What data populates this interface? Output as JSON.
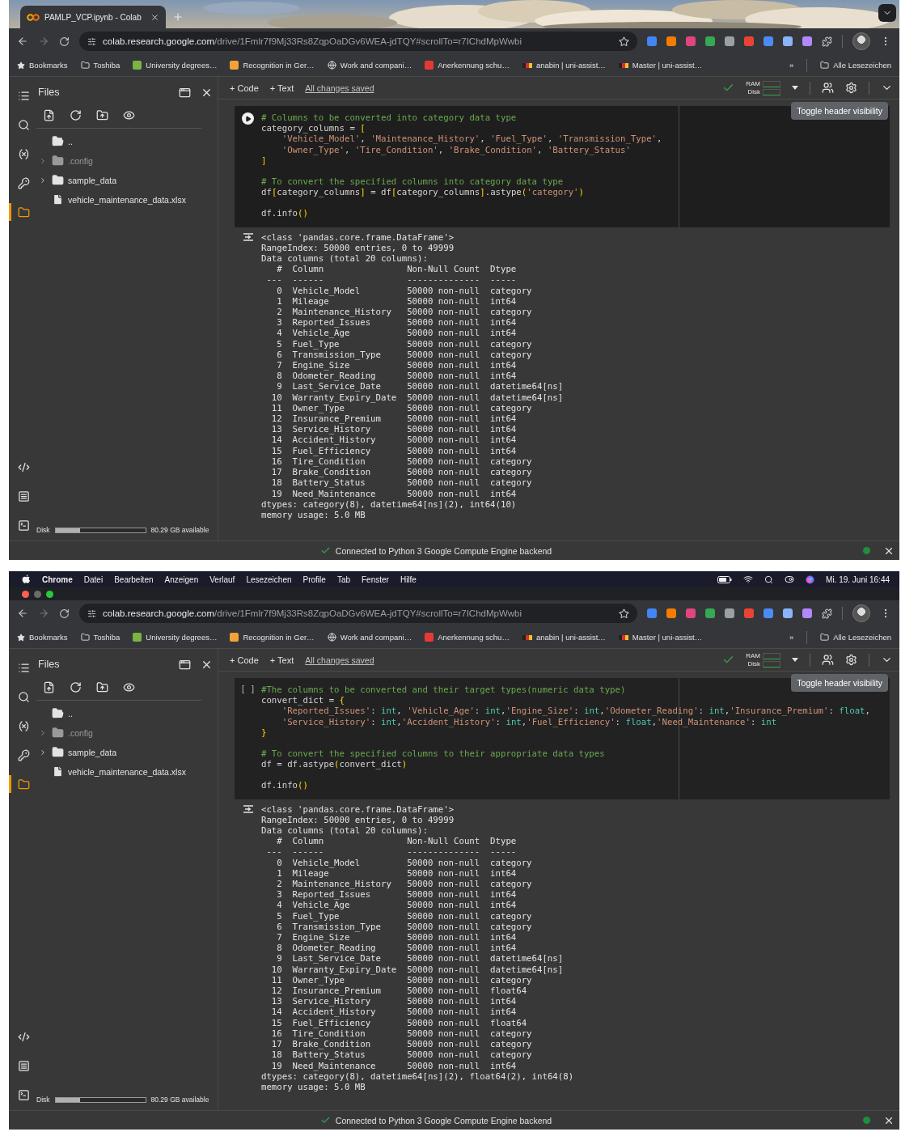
{
  "windows": [
    {
      "tabs": [
        {
          "title": "PAMLP_VCP.ipynb - Colab",
          "selected": true
        }
      ],
      "address": {
        "host": "colab.research.google.com",
        "path": "/drive/1Fmlr7f9Mj33Rs8ZqpOaDGv6WEA-jdTQY#scrollTo=r7IChdMpWwbi"
      },
      "bookmarks": [
        {
          "label": "Bookmarks",
          "kind": "star"
        },
        {
          "label": "Toshiba",
          "kind": "folder"
        },
        {
          "label": "University degrees…",
          "kind": "site",
          "color": "#7cb342"
        },
        {
          "label": "Recognition in Ger…",
          "kind": "site",
          "color": "#f4a13a"
        },
        {
          "label": "Work and compani…",
          "kind": "globe"
        },
        {
          "label": "Anerkennung schu…",
          "kind": "site",
          "color": "#e53935"
        },
        {
          "label": "anabin | uni-assist…",
          "kind": "flag",
          "color": "#d32f2f"
        },
        {
          "label": "Master | uni-assist…",
          "kind": "flag",
          "color": "#d32f2f"
        }
      ],
      "more_bookmarks": "»",
      "all_bookmarks": "Alle Lesezeichen",
      "rail": [
        {
          "kind": "toc",
          "selected": false
        },
        {
          "kind": "search",
          "selected": false
        },
        {
          "kind": "variables",
          "selected": false
        },
        {
          "kind": "secrets",
          "selected": false
        },
        {
          "kind": "files",
          "selected": true
        }
      ],
      "rail_bottom": [
        {
          "kind": "code",
          "selected": false
        },
        {
          "kind": "snippets",
          "selected": false
        },
        {
          "kind": "terminal",
          "selected": false
        }
      ],
      "files": {
        "title": "Files",
        "tree": [
          {
            "name": "..",
            "kind": "parent"
          },
          {
            "name": ".config",
            "kind": "folder",
            "expanded": false,
            "dimmed": true
          },
          {
            "name": "sample_data",
            "kind": "folder",
            "expanded": false,
            "dimmed": false
          },
          {
            "name": "vehicle_maintenance_data.xlsx",
            "kind": "file"
          }
        ],
        "disk": {
          "label": "Disk",
          "level": 0.27,
          "reading": "80.29 GB available"
        }
      },
      "toolbar": {
        "add_code": "+ Code",
        "add_text": "+ Text",
        "save_status": "All changes saved",
        "ram": "RAM",
        "disk": "Disk",
        "tooltip": "Toggle header visibility"
      },
      "cell": {
        "focused": true,
        "code": [
          [
            {
              "tokens": [
                {
                  "kind": "comment",
                  "text": "# Columns to be converted into category data type"
                }
              ]
            },
            {
              "tokens": [
                {
                  "kind": "plain",
                  "text": "category_columns = "
                },
                {
                  "kind": "bracket",
                  "text": "["
                }
              ]
            },
            {
              "indented": true,
              "tokens": [
                {
                  "kind": "string",
                  "text": "'Vehicle_Model'"
                },
                {
                  "kind": "plain",
                  "text": ", "
                },
                {
                  "kind": "string",
                  "text": "'Maintenance_History'"
                },
                {
                  "kind": "plain",
                  "text": ", "
                },
                {
                  "kind": "string",
                  "text": "'Fuel_Type'"
                },
                {
                  "kind": "plain",
                  "text": ", "
                },
                {
                  "kind": "string",
                  "text": "'Transmission_Type'"
                },
                {
                  "kind": "plain",
                  "text": ","
                }
              ]
            },
            {
              "indented": true,
              "tokens": [
                {
                  "kind": "string",
                  "text": "'Owner_Type'"
                },
                {
                  "kind": "plain",
                  "text": ", "
                },
                {
                  "kind": "string",
                  "text": "'Tire_Condition'"
                },
                {
                  "kind": "plain",
                  "text": ", "
                },
                {
                  "kind": "string",
                  "text": "'Brake_Condition'"
                },
                {
                  "kind": "plain",
                  "text": ", "
                },
                {
                  "kind": "string",
                  "text": "'Battery_Status'"
                }
              ]
            },
            {
              "tokens": [
                {
                  "kind": "bracket",
                  "text": "]"
                }
              ]
            }
          ],
          [
            {
              "tokens": [
                {
                  "kind": "comment",
                  "text": "# To convert the specified columns into category data type"
                }
              ]
            },
            {
              "tokens": [
                {
                  "kind": "plain",
                  "text": "df"
                },
                {
                  "kind": "bracket",
                  "text": "["
                },
                {
                  "kind": "plain",
                  "text": "category_columns"
                },
                {
                  "kind": "bracket",
                  "text": "]"
                },
                {
                  "kind": "plain",
                  "text": " = df"
                },
                {
                  "kind": "bracket",
                  "text": "["
                },
                {
                  "kind": "plain",
                  "text": "category_columns"
                },
                {
                  "kind": "bracket",
                  "text": "]"
                },
                {
                  "kind": "plain",
                  "text": ".astype"
                },
                {
                  "kind": "bracket",
                  "text": "("
                },
                {
                  "kind": "string",
                  "text": "'category'"
                },
                {
                  "kind": "bracket",
                  "text": ")"
                }
              ]
            }
          ],
          [
            {
              "tokens": [
                {
                  "kind": "plain",
                  "text": "df.info"
                },
                {
                  "kind": "bracket",
                  "text": "()"
                }
              ]
            }
          ]
        ],
        "output": {
          "lines": [
            "<class 'pandas.core.frame.DataFrame'>",
            "RangeIndex: 50000 entries, 0 to 49999",
            "Data columns (total 20 columns):"
          ],
          "columns": [
            "#",
            "Column",
            "Non-Null Count",
            "Dtype"
          ],
          "rules": [
            "---",
            "------",
            "--------------",
            "-----"
          ],
          "rows": [
            [
              "0",
              "Vehicle_Model",
              "50000 non-null",
              "category"
            ],
            [
              "1",
              "Mileage",
              "50000 non-null",
              "int64"
            ],
            [
              "2",
              "Maintenance_History",
              "50000 non-null",
              "category"
            ],
            [
              "3",
              "Reported_Issues",
              "50000 non-null",
              "int64"
            ],
            [
              "4",
              "Vehicle_Age",
              "50000 non-null",
              "int64"
            ],
            [
              "5",
              "Fuel_Type",
              "50000 non-null",
              "category"
            ],
            [
              "6",
              "Transmission_Type",
              "50000 non-null",
              "category"
            ],
            [
              "7",
              "Engine_Size",
              "50000 non-null",
              "int64"
            ],
            [
              "8",
              "Odometer_Reading",
              "50000 non-null",
              "int64"
            ],
            [
              "9",
              "Last_Service_Date",
              "50000 non-null",
              "datetime64[ns]"
            ],
            [
              "10",
              "Warranty_Expiry_Date",
              "50000 non-null",
              "datetime64[ns]"
            ],
            [
              "11",
              "Owner_Type",
              "50000 non-null",
              "category"
            ],
            [
              "12",
              "Insurance_Premium",
              "50000 non-null",
              "int64"
            ],
            [
              "13",
              "Service_History",
              "50000 non-null",
              "int64"
            ],
            [
              "14",
              "Accident_History",
              "50000 non-null",
              "int64"
            ],
            [
              "15",
              "Fuel_Efficiency",
              "50000 non-null",
              "int64"
            ],
            [
              "16",
              "Tire_Condition",
              "50000 non-null",
              "category"
            ],
            [
              "17",
              "Brake_Condition",
              "50000 non-null",
              "category"
            ],
            [
              "18",
              "Battery_Status",
              "50000 non-null",
              "category"
            ],
            [
              "19",
              "Need_Maintenance",
              "50000 non-null",
              "int64"
            ]
          ],
          "footer": [
            "dtypes: category(8), datetime64[ns](2), int64(10)",
            "memory usage: 5.0 MB"
          ]
        }
      },
      "status": "Connected to Python 3 Google Compute Engine backend"
    },
    {
      "menu_bar": {
        "items": [
          {
            "label": "Chrome",
            "kind": "app"
          },
          {
            "label": "Datei",
            "kind": "menu"
          },
          {
            "label": "Bearbeiten",
            "kind": "menu"
          },
          {
            "label": "Anzeigen",
            "kind": "menu"
          },
          {
            "label": "Verlauf",
            "kind": "menu"
          },
          {
            "label": "Lesezeichen",
            "kind": "menu"
          },
          {
            "label": "Profile",
            "kind": "menu"
          },
          {
            "label": "Tab",
            "kind": "menu"
          },
          {
            "label": "Fenster",
            "kind": "menu"
          },
          {
            "label": "Hilfe",
            "kind": "menu"
          }
        ],
        "clock": "Mi. 19. Juni  16:44"
      },
      "address": {
        "host": "colab.research.google.com",
        "path": "/drive/1Fmlr7f9Mj33Rs8ZqpOaDGv6WEA-jdTQY#scrollTo=r7IChdMpWwbi"
      },
      "bookmarks": [
        {
          "label": "Bookmarks",
          "kind": "star"
        },
        {
          "label": "Toshiba",
          "kind": "folder"
        },
        {
          "label": "University degrees…",
          "kind": "site",
          "color": "#7cb342"
        },
        {
          "label": "Recognition in Ger…",
          "kind": "site",
          "color": "#f4a13a"
        },
        {
          "label": "Work and compani…",
          "kind": "globe"
        },
        {
          "label": "Anerkennung schu…",
          "kind": "site",
          "color": "#e53935"
        },
        {
          "label": "anabin | uni-assist…",
          "kind": "flag",
          "color": "#d32f2f"
        },
        {
          "label": "Master | uni-assist…",
          "kind": "flag",
          "color": "#d32f2f"
        }
      ],
      "more_bookmarks": "»",
      "all_bookmarks": "Alle Lesezeichen",
      "rail": [
        {
          "kind": "toc",
          "selected": false
        },
        {
          "kind": "search",
          "selected": false
        },
        {
          "kind": "variables",
          "selected": false
        },
        {
          "kind": "secrets",
          "selected": false
        },
        {
          "kind": "files",
          "selected": true
        }
      ],
      "rail_bottom": [
        {
          "kind": "code",
          "selected": false
        },
        {
          "kind": "snippets",
          "selected": false
        },
        {
          "kind": "terminal",
          "selected": false
        }
      ],
      "files": {
        "title": "Files",
        "tree": [
          {
            "name": "..",
            "kind": "parent"
          },
          {
            "name": ".config",
            "kind": "folder",
            "expanded": false,
            "dimmed": true
          },
          {
            "name": "sample_data",
            "kind": "folder",
            "expanded": false,
            "dimmed": false
          },
          {
            "name": "vehicle_maintenance_data.xlsx",
            "kind": "file"
          }
        ],
        "disk": {
          "label": "Disk",
          "level": 0.27,
          "reading": "80.29 GB available"
        }
      },
      "toolbar": {
        "add_code": "+ Code",
        "add_text": "+ Text",
        "save_status": "All changes saved",
        "ram": "RAM",
        "disk": "Disk",
        "tooltip": "Toggle header visibility"
      },
      "cell": {
        "focused": false,
        "prompt": "[ ]",
        "code": [
          [
            {
              "tokens": [
                {
                  "kind": "comment",
                  "text": "#The columns to be converted and their target types(numeric data type)"
                }
              ]
            },
            {
              "tokens": [
                {
                  "kind": "plain",
                  "text": "convert_dict = "
                },
                {
                  "kind": "bracket",
                  "text": "{"
                }
              ]
            },
            {
              "indented": true,
              "tokens": [
                {
                  "kind": "string",
                  "text": "'Reported_Issues'"
                },
                {
                  "kind": "plain",
                  "text": ": "
                },
                {
                  "kind": "type",
                  "text": "int"
                },
                {
                  "kind": "plain",
                  "text": ", "
                },
                {
                  "kind": "string",
                  "text": "'Vehicle_Age'"
                },
                {
                  "kind": "plain",
                  "text": ": "
                },
                {
                  "kind": "type",
                  "text": "int"
                },
                {
                  "kind": "plain",
                  "text": ","
                },
                {
                  "kind": "string",
                  "text": "'Engine_Size'"
                },
                {
                  "kind": "plain",
                  "text": ": "
                },
                {
                  "kind": "type",
                  "text": "int"
                },
                {
                  "kind": "plain",
                  "text": ","
                },
                {
                  "kind": "string",
                  "text": "'Odometer_Reading'"
                },
                {
                  "kind": "plain",
                  "text": ": "
                },
                {
                  "kind": "type",
                  "text": "int"
                },
                {
                  "kind": "plain",
                  "text": ","
                },
                {
                  "kind": "string",
                  "text": "'Insurance_Premium'"
                },
                {
                  "kind": "plain",
                  "text": ": "
                },
                {
                  "kind": "type",
                  "text": "float"
                },
                {
                  "kind": "plain",
                  "text": ","
                }
              ]
            },
            {
              "indented": true,
              "tokens": [
                {
                  "kind": "string",
                  "text": "'Service_History'"
                },
                {
                  "kind": "plain",
                  "text": ": "
                },
                {
                  "kind": "type",
                  "text": "int"
                },
                {
                  "kind": "plain",
                  "text": ","
                },
                {
                  "kind": "string",
                  "text": "'Accident_History'"
                },
                {
                  "kind": "plain",
                  "text": ": "
                },
                {
                  "kind": "type",
                  "text": "int"
                },
                {
                  "kind": "plain",
                  "text": ","
                },
                {
                  "kind": "string",
                  "text": "'Fuel_Efficiency'"
                },
                {
                  "kind": "plain",
                  "text": ": "
                },
                {
                  "kind": "type",
                  "text": "float"
                },
                {
                  "kind": "plain",
                  "text": ","
                },
                {
                  "kind": "string",
                  "text": "'Need_Maintenance'"
                },
                {
                  "kind": "plain",
                  "text": ": "
                },
                {
                  "kind": "type",
                  "text": "int"
                }
              ]
            },
            {
              "tokens": [
                {
                  "kind": "bracket",
                  "text": "}"
                }
              ]
            }
          ],
          [
            {
              "tokens": [
                {
                  "kind": "comment",
                  "text": "# To convert the specified columns to their appropriate data types"
                }
              ]
            },
            {
              "tokens": [
                {
                  "kind": "plain",
                  "text": "df = df.astype"
                },
                {
                  "kind": "bracket",
                  "text": "("
                },
                {
                  "kind": "plain",
                  "text": "convert_dict"
                },
                {
                  "kind": "bracket",
                  "text": ")"
                }
              ]
            }
          ],
          [
            {
              "tokens": [
                {
                  "kind": "plain",
                  "text": "df.info"
                },
                {
                  "kind": "bracket",
                  "text": "()"
                }
              ]
            }
          ]
        ],
        "output": {
          "lines": [
            "<class 'pandas.core.frame.DataFrame'>",
            "RangeIndex: 50000 entries, 0 to 49999",
            "Data columns (total 20 columns):"
          ],
          "columns": [
            "#",
            "Column",
            "Non-Null Count",
            "Dtype"
          ],
          "rules": [
            "---",
            "------",
            "--------------",
            "-----"
          ],
          "rows": [
            [
              "0",
              "Vehicle_Model",
              "50000 non-null",
              "category"
            ],
            [
              "1",
              "Mileage",
              "50000 non-null",
              "int64"
            ],
            [
              "2",
              "Maintenance_History",
              "50000 non-null",
              "category"
            ],
            [
              "3",
              "Reported_Issues",
              "50000 non-null",
              "int64"
            ],
            [
              "4",
              "Vehicle_Age",
              "50000 non-null",
              "int64"
            ],
            [
              "5",
              "Fuel_Type",
              "50000 non-null",
              "category"
            ],
            [
              "6",
              "Transmission_Type",
              "50000 non-null",
              "category"
            ],
            [
              "7",
              "Engine_Size",
              "50000 non-null",
              "int64"
            ],
            [
              "8",
              "Odometer_Reading",
              "50000 non-null",
              "int64"
            ],
            [
              "9",
              "Last_Service_Date",
              "50000 non-null",
              "datetime64[ns]"
            ],
            [
              "10",
              "Warranty_Expiry_Date",
              "50000 non-null",
              "datetime64[ns]"
            ],
            [
              "11",
              "Owner_Type",
              "50000 non-null",
              "category"
            ],
            [
              "12",
              "Insurance_Premium",
              "50000 non-null",
              "float64"
            ],
            [
              "13",
              "Service_History",
              "50000 non-null",
              "int64"
            ],
            [
              "14",
              "Accident_History",
              "50000 non-null",
              "int64"
            ],
            [
              "15",
              "Fuel_Efficiency",
              "50000 non-null",
              "float64"
            ],
            [
              "16",
              "Tire_Condition",
              "50000 non-null",
              "category"
            ],
            [
              "17",
              "Brake_Condition",
              "50000 non-null",
              "category"
            ],
            [
              "18",
              "Battery_Status",
              "50000 non-null",
              "category"
            ],
            [
              "19",
              "Need_Maintenance",
              "50000 non-null",
              "int64"
            ]
          ],
          "footer": [
            "dtypes: category(8), datetime64[ns](2), float64(2), int64(8)",
            "memory usage: 5.0 MB"
          ]
        }
      },
      "status": "Connected to Python 3 Google Compute Engine backend"
    }
  ]
}
